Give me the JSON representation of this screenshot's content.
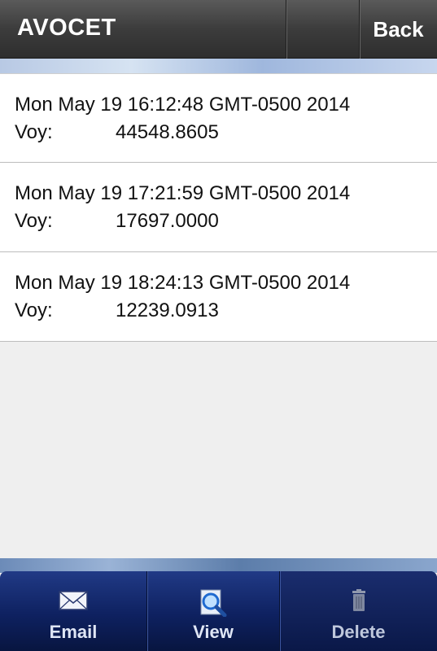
{
  "header": {
    "title": "AVOCET",
    "back_label": "Back"
  },
  "entries": [
    {
      "date": "Mon May 19 16:12:48 GMT-0500 2014",
      "voy_label": "Voy:",
      "voy_value": "44548.8605"
    },
    {
      "date": "Mon May 19 17:21:59 GMT-0500 2014",
      "voy_label": "Voy:",
      "voy_value": "17697.0000"
    },
    {
      "date": "Mon May 19 18:24:13 GMT-0500 2014",
      "voy_label": "Voy:",
      "voy_value": "12239.0913"
    }
  ],
  "tabbar": {
    "email": {
      "label": "Email",
      "icon": "envelope-icon"
    },
    "view": {
      "label": "View",
      "icon": "magnifier-icon"
    },
    "delete": {
      "label": "Delete",
      "icon": "trash-icon"
    }
  }
}
